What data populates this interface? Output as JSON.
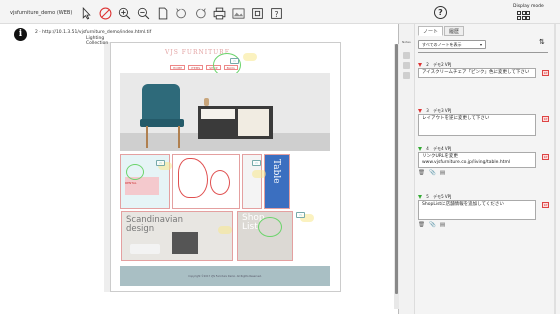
{
  "app": {
    "title": "vjsfurniture_demo (WEB)"
  },
  "toolbar": {
    "icons": [
      "pointer-icon",
      "no-entry-icon",
      "zoom-in-icon",
      "zoom-out-icon",
      "page-icon",
      "rotate-left-icon",
      "rotate-right-icon",
      "print-icon",
      "image-icon",
      "grid-icon",
      "question-icon"
    ]
  },
  "header_right": {
    "help_icon": "?",
    "display_mode_label": "Display mode"
  },
  "viewer": {
    "info_icon": "i",
    "url": "2 · http://10.1.3.51/vjsfurniture_demo/index.html.tif",
    "side_label": "Notes"
  },
  "site": {
    "logo": "VJS FURNITURE",
    "nav": [
      "HOME",
      "ITEMS",
      "SHOP",
      "BLOG"
    ],
    "tiles": {
      "cyan_label": "RENTAL",
      "lighting": "Lighting\nCollection",
      "blue_vertical": "Table",
      "scandinavian": "Scandinavian\ndesign",
      "shop_list": "Shop\nList"
    },
    "footer": "Copyright ©2017 VJS Furniture Demo. All Rights Reserved."
  },
  "notes_panel": {
    "tabs": [
      {
        "label": "ノート",
        "active": true
      },
      {
        "label": "履歴",
        "active": false
      }
    ],
    "filter": "すべてのノートを表示",
    "filter_arrow": "▾",
    "sort_icon": "⇅",
    "notes": [
      {
        "num": "2",
        "author": "デモ2 VPJ",
        "status": "red",
        "body": "アイスクリームチェア「ピンク」色に変更して下さい",
        "flag": "1P"
      },
      {
        "num": "3",
        "author": "デモ3 VPJ",
        "status": "red",
        "body": "レイアウトを逆に変更して下さい",
        "flag": "1P"
      },
      {
        "num": "4",
        "author": "デモ4 VPJ",
        "status": "green",
        "body": "リンクURLを変更\nwww.vjsfurniture.co.jp/living/table.html",
        "flag": "1P"
      },
      {
        "num": "5",
        "author": "デモ5 VPJ",
        "status": "green",
        "body": "ShopListに店舗情報を追加してください",
        "flag": "1P"
      }
    ],
    "tool_icons": [
      "🗑",
      "📎",
      "▤"
    ]
  }
}
